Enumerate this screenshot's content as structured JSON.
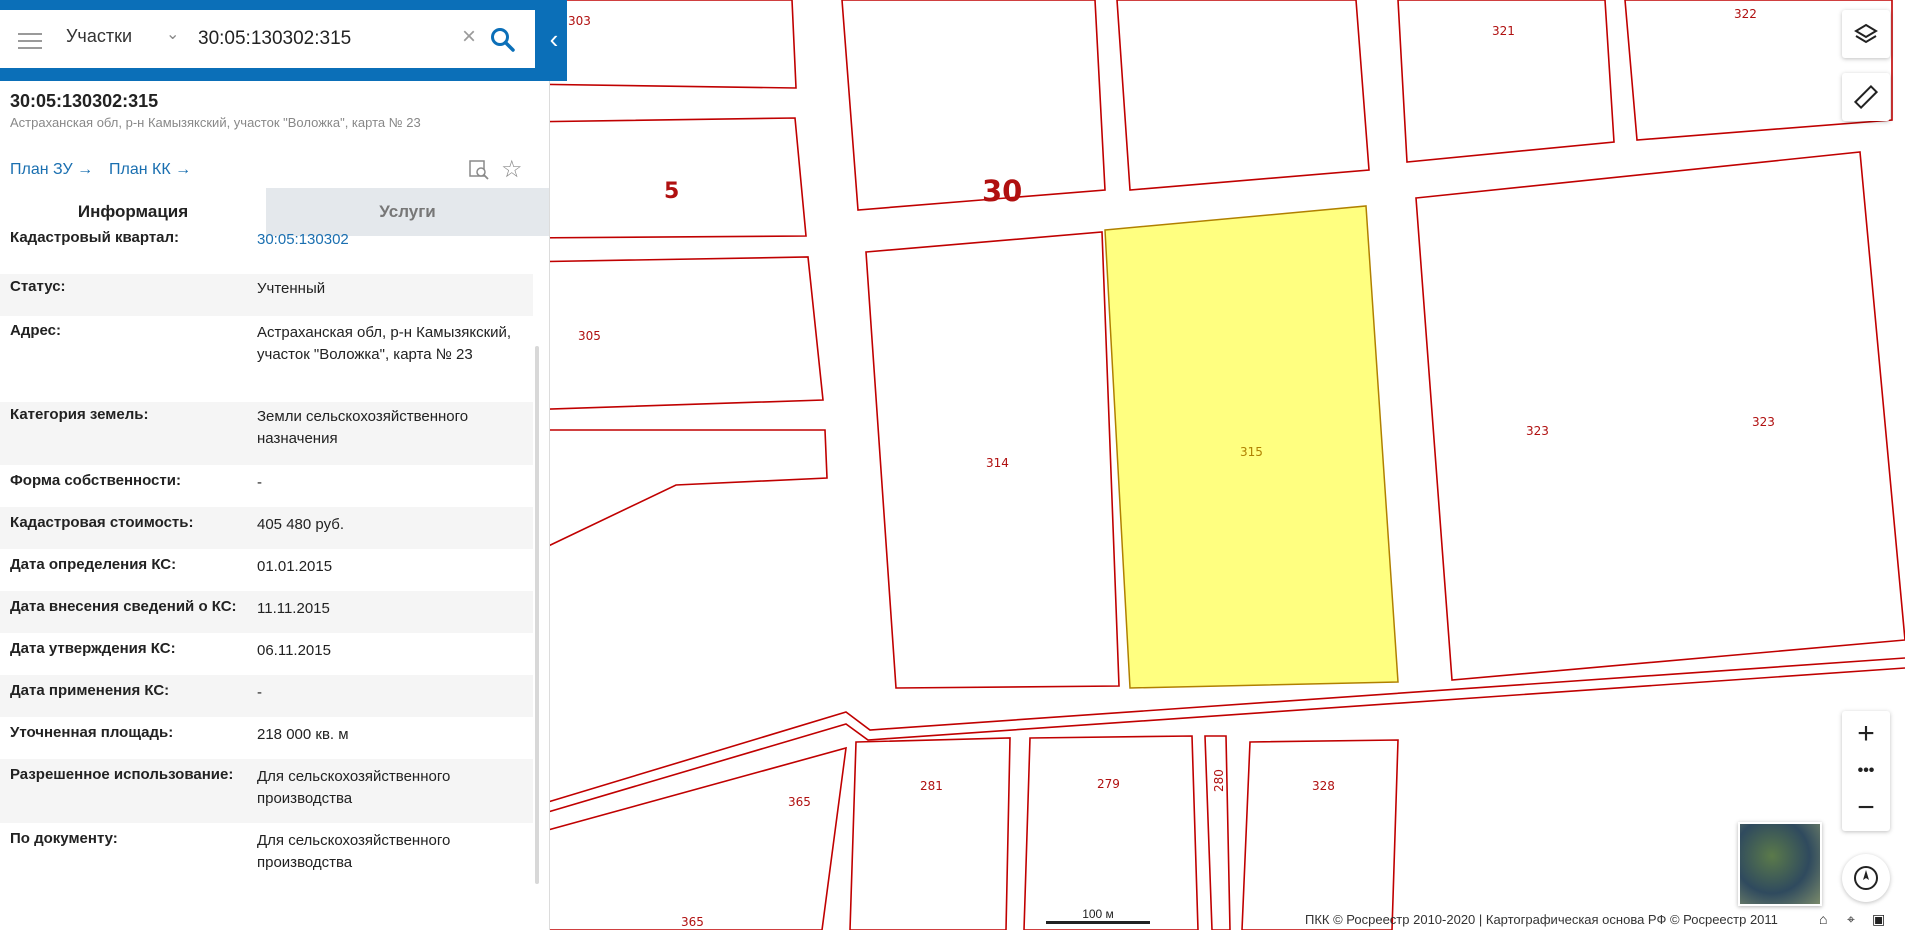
{
  "search": {
    "type": "Участки",
    "query": "30:05:130302:315"
  },
  "object": {
    "cadastral_number": "30:05:130302:315",
    "address_short": "Астраханская обл, р-н Камызякский, участок \"Воложка\", карта № 23",
    "plan_zu": "План ЗУ",
    "plan_kk": "План КК"
  },
  "tabs": {
    "info": "Информация",
    "services": "Услуги"
  },
  "info": [
    {
      "label": "Кадастровый квартал:",
      "value": "30:05:130302",
      "link": true
    },
    {
      "label": "Статус:",
      "value": "Учтенный"
    },
    {
      "label": "Адрес:",
      "value": "Астраханская обл, р-н Камызякский, участок \"Воложка\", карта № 23"
    },
    {
      "label": "Категория земель:",
      "value": "Земли сельскохозяйственного назначения"
    },
    {
      "label": "Форма собственности:",
      "value": "-"
    },
    {
      "label": "Кадастровая стоимость:",
      "value": "405 480 руб."
    },
    {
      "label": "Дата определения КС:",
      "value": "01.01.2015"
    },
    {
      "label": "Дата внесения сведений о КС:",
      "value": "11.11.2015"
    },
    {
      "label": "Дата утверждения КС:",
      "value": "06.11.2015"
    },
    {
      "label": "Дата применения КС:",
      "value": "-"
    },
    {
      "label": "Уточненная площадь:",
      "value": "218 000 кв. м"
    },
    {
      "label": "Разрешенное использование:",
      "value": "Для сельскохозяйственного производства"
    },
    {
      "label": "По документу:",
      "value": "Для сельскохозяйственного производства"
    }
  ],
  "map": {
    "labels": {
      "p303": "303",
      "p321": "321",
      "p322": "322",
      "p5": "5",
      "p30": "30",
      "p305": "305",
      "p314": "314",
      "p315": "315",
      "p323a": "323",
      "p323b": "323",
      "p281": "281",
      "p279": "279",
      "p280": "280",
      "p328": "328",
      "p365a": "365",
      "p365b": "365"
    },
    "scale": "100 м",
    "copyright": "ПКК © Росреестр 2010-2020 | Картографическая основа РФ © Росреестр 2011",
    "colors": {
      "boundary": "#c00000",
      "selected_fill": "#ffff80",
      "accent": "#0b6fb8"
    }
  },
  "icons": [
    "menu-icon",
    "chevron-down-icon",
    "close-icon",
    "search-icon",
    "chevron-left-icon",
    "arrow-right-icon",
    "find-on-map-icon",
    "star-icon",
    "layers-icon",
    "ruler-icon",
    "zoom-in-icon",
    "more-icon",
    "zoom-out-icon",
    "compass-icon",
    "home-icon",
    "locate-icon",
    "panel-icon"
  ]
}
